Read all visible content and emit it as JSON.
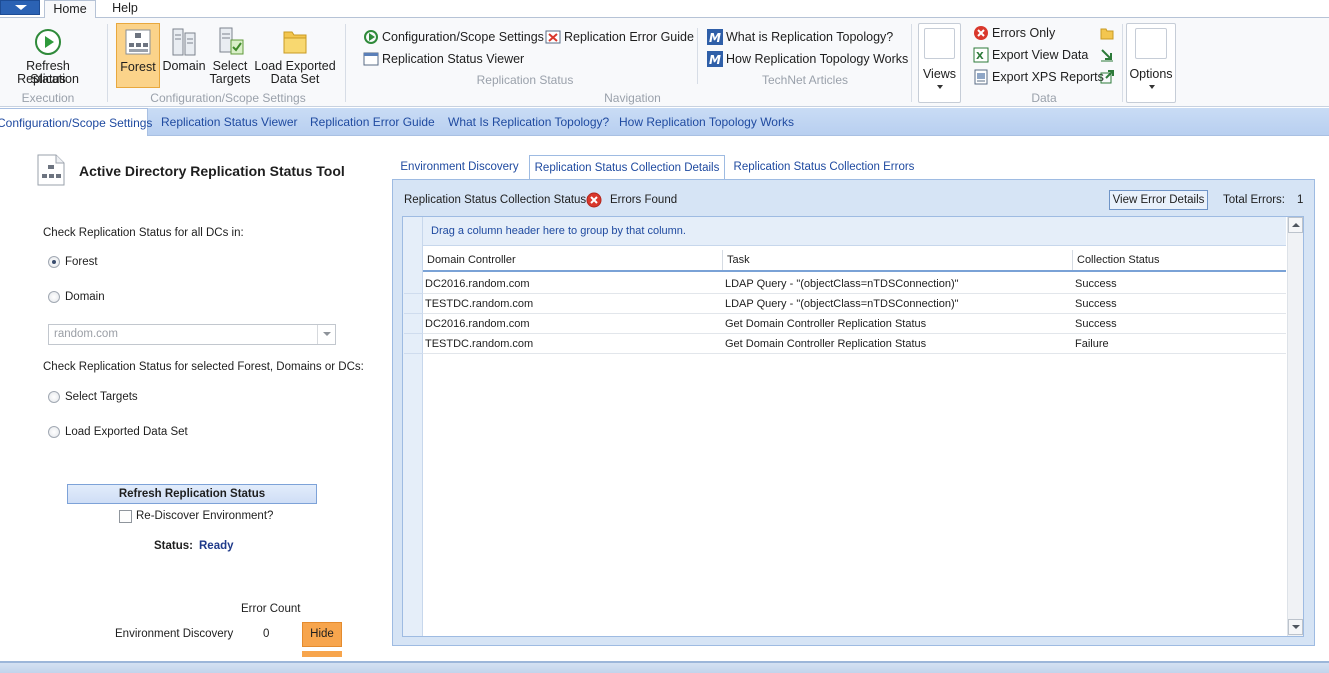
{
  "ribbon": {
    "tabs": [
      "Home",
      "Help"
    ],
    "execution": {
      "refresh_label_1": "Refresh Replication",
      "refresh_label_2": "Status",
      "group_label": "Execution"
    },
    "config_scope": {
      "forest": "Forest",
      "domain": "Domain",
      "select_targets_1": "Select",
      "select_targets_2": "Targets",
      "load_exported_1": "Load Exported",
      "load_exported_2": "Data Set",
      "group_label": "Configuration/Scope Settings"
    },
    "navigation": {
      "config_scope_settings": "Configuration/Scope Settings",
      "replication_status_viewer": "Replication Status Viewer",
      "replication_error_guide": "Replication Error Guide",
      "replication_status_label": "Replication Status",
      "what_is_topology": "What is Replication Topology?",
      "how_topology_works": "How Replication Topology Works",
      "technet_label": "TechNet Articles",
      "group_label": "Navigation"
    },
    "data": {
      "views": "Views",
      "errors_only": "Errors Only",
      "export_view_data": "Export View Data",
      "export_xps": "Export XPS Reports",
      "group_label": "Data",
      "options": "Options"
    }
  },
  "command_bar": [
    "Configuration/Scope Settings",
    "Replication Status Viewer",
    "Replication Error Guide",
    "What Is Replication Topology?",
    "How Replication Topology Works"
  ],
  "left_panel": {
    "title": "Active Directory Replication Status Tool",
    "check_all_label": "Check Replication Status for all DCs in:",
    "radio_forest": "Forest",
    "radio_domain": "Domain",
    "domain_value": "random.com",
    "check_selected_label": "Check Replication Status for selected Forest, Domains or DCs:",
    "radio_select_targets": "Select Targets",
    "radio_load_exported": "Load Exported Data Set",
    "refresh_button": "Refresh Replication Status",
    "rediscover_label": "Re-Discover Environment?",
    "status_label": "Status:",
    "status_value": "Ready",
    "error_count_header": "Error Count",
    "env_discovery_label": "Environment Discovery",
    "env_discovery_count": "0",
    "hide_button": "Hide"
  },
  "right_panel": {
    "tabs": [
      "Environment Discovery",
      "Replication Status Collection Details",
      "Replication Status Collection Errors"
    ],
    "collection_status_label": "Replication Status Collection Status:",
    "collection_status_value": "Errors Found",
    "view_error_details": "View Error Details",
    "total_errors_label": "Total Errors:",
    "total_errors_value": "1",
    "group_hint": "Drag a column header here to group by that column.",
    "columns": [
      "Domain Controller",
      "Task",
      "Collection Status"
    ],
    "rows": [
      [
        "DC2016.random.com",
        "LDAP Query - \"(objectClass=nTDSConnection)\"",
        "Success"
      ],
      [
        "TESTDC.random.com",
        "LDAP Query - \"(objectClass=nTDSConnection)\"",
        "Success"
      ],
      [
        "DC2016.random.com",
        "Get Domain Controller Replication Status",
        "Success"
      ],
      [
        "TESTDC.random.com",
        "Get Domain Controller Replication Status",
        "Failure"
      ]
    ]
  },
  "colors": {
    "accent_blue": "#1f4aa0",
    "command_bar": "#c0d5f2",
    "hide_orange": "#f7a54d",
    "error_red": "#d9382c"
  }
}
